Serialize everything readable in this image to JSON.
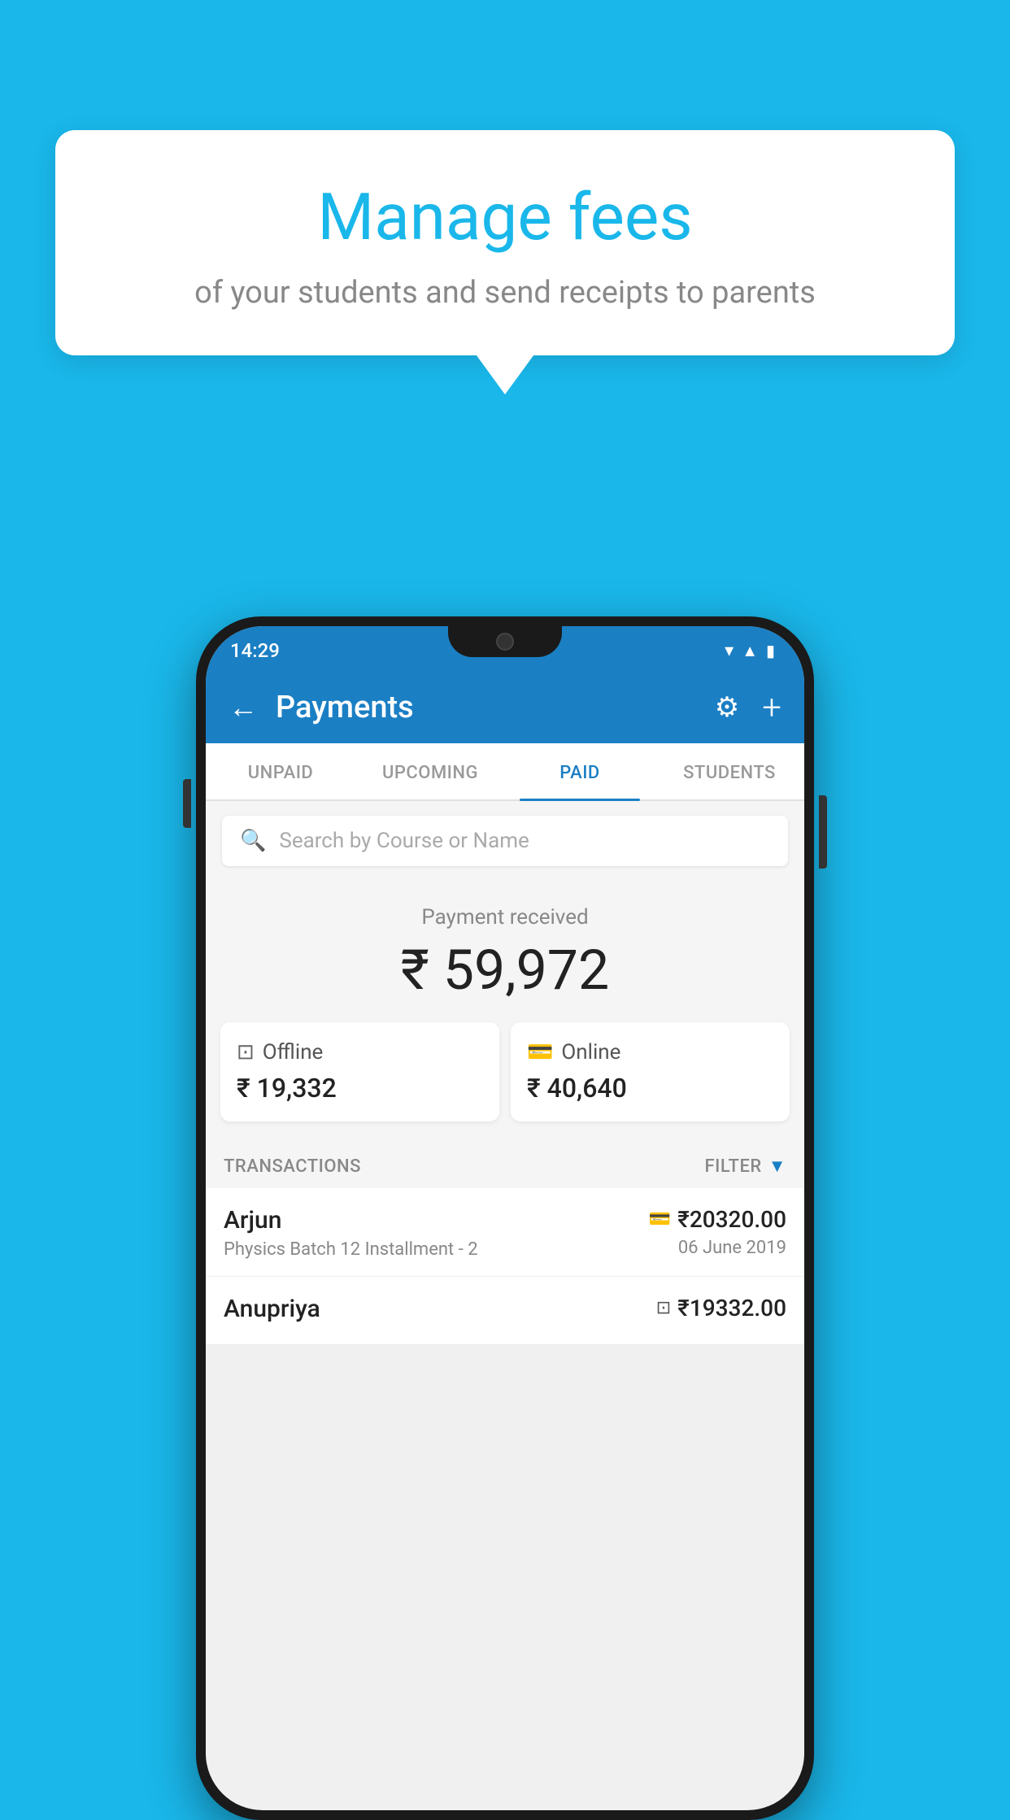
{
  "page": {
    "background_color": "#1ab7ea"
  },
  "tooltip": {
    "title": "Manage fees",
    "subtitle": "of your students and send receipts to parents"
  },
  "status_bar": {
    "time": "14:29",
    "wifi": "▼",
    "signal": "▲",
    "battery": "▮"
  },
  "header": {
    "title": "Payments",
    "back_label": "←",
    "settings_icon": "⚙",
    "add_icon": "+"
  },
  "tabs": [
    {
      "label": "UNPAID",
      "active": false
    },
    {
      "label": "UPCOMING",
      "active": false
    },
    {
      "label": "PAID",
      "active": true
    },
    {
      "label": "STUDENTS",
      "active": false
    }
  ],
  "search": {
    "placeholder": "Search by Course or Name"
  },
  "payment_summary": {
    "label": "Payment received",
    "total": "₹ 59,972",
    "offline_label": "Offline",
    "offline_amount": "₹ 19,332",
    "online_label": "Online",
    "online_amount": "₹ 40,640"
  },
  "transactions": {
    "header_label": "TRANSACTIONS",
    "filter_label": "FILTER",
    "rows": [
      {
        "name": "Arjun",
        "desc": "Physics Batch 12 Installment - 2",
        "amount": "₹20320.00",
        "date": "06 June 2019",
        "mode": "online"
      },
      {
        "name": "Anupriya",
        "desc": "",
        "amount": "₹19332.00",
        "date": "",
        "mode": "offline"
      }
    ]
  }
}
